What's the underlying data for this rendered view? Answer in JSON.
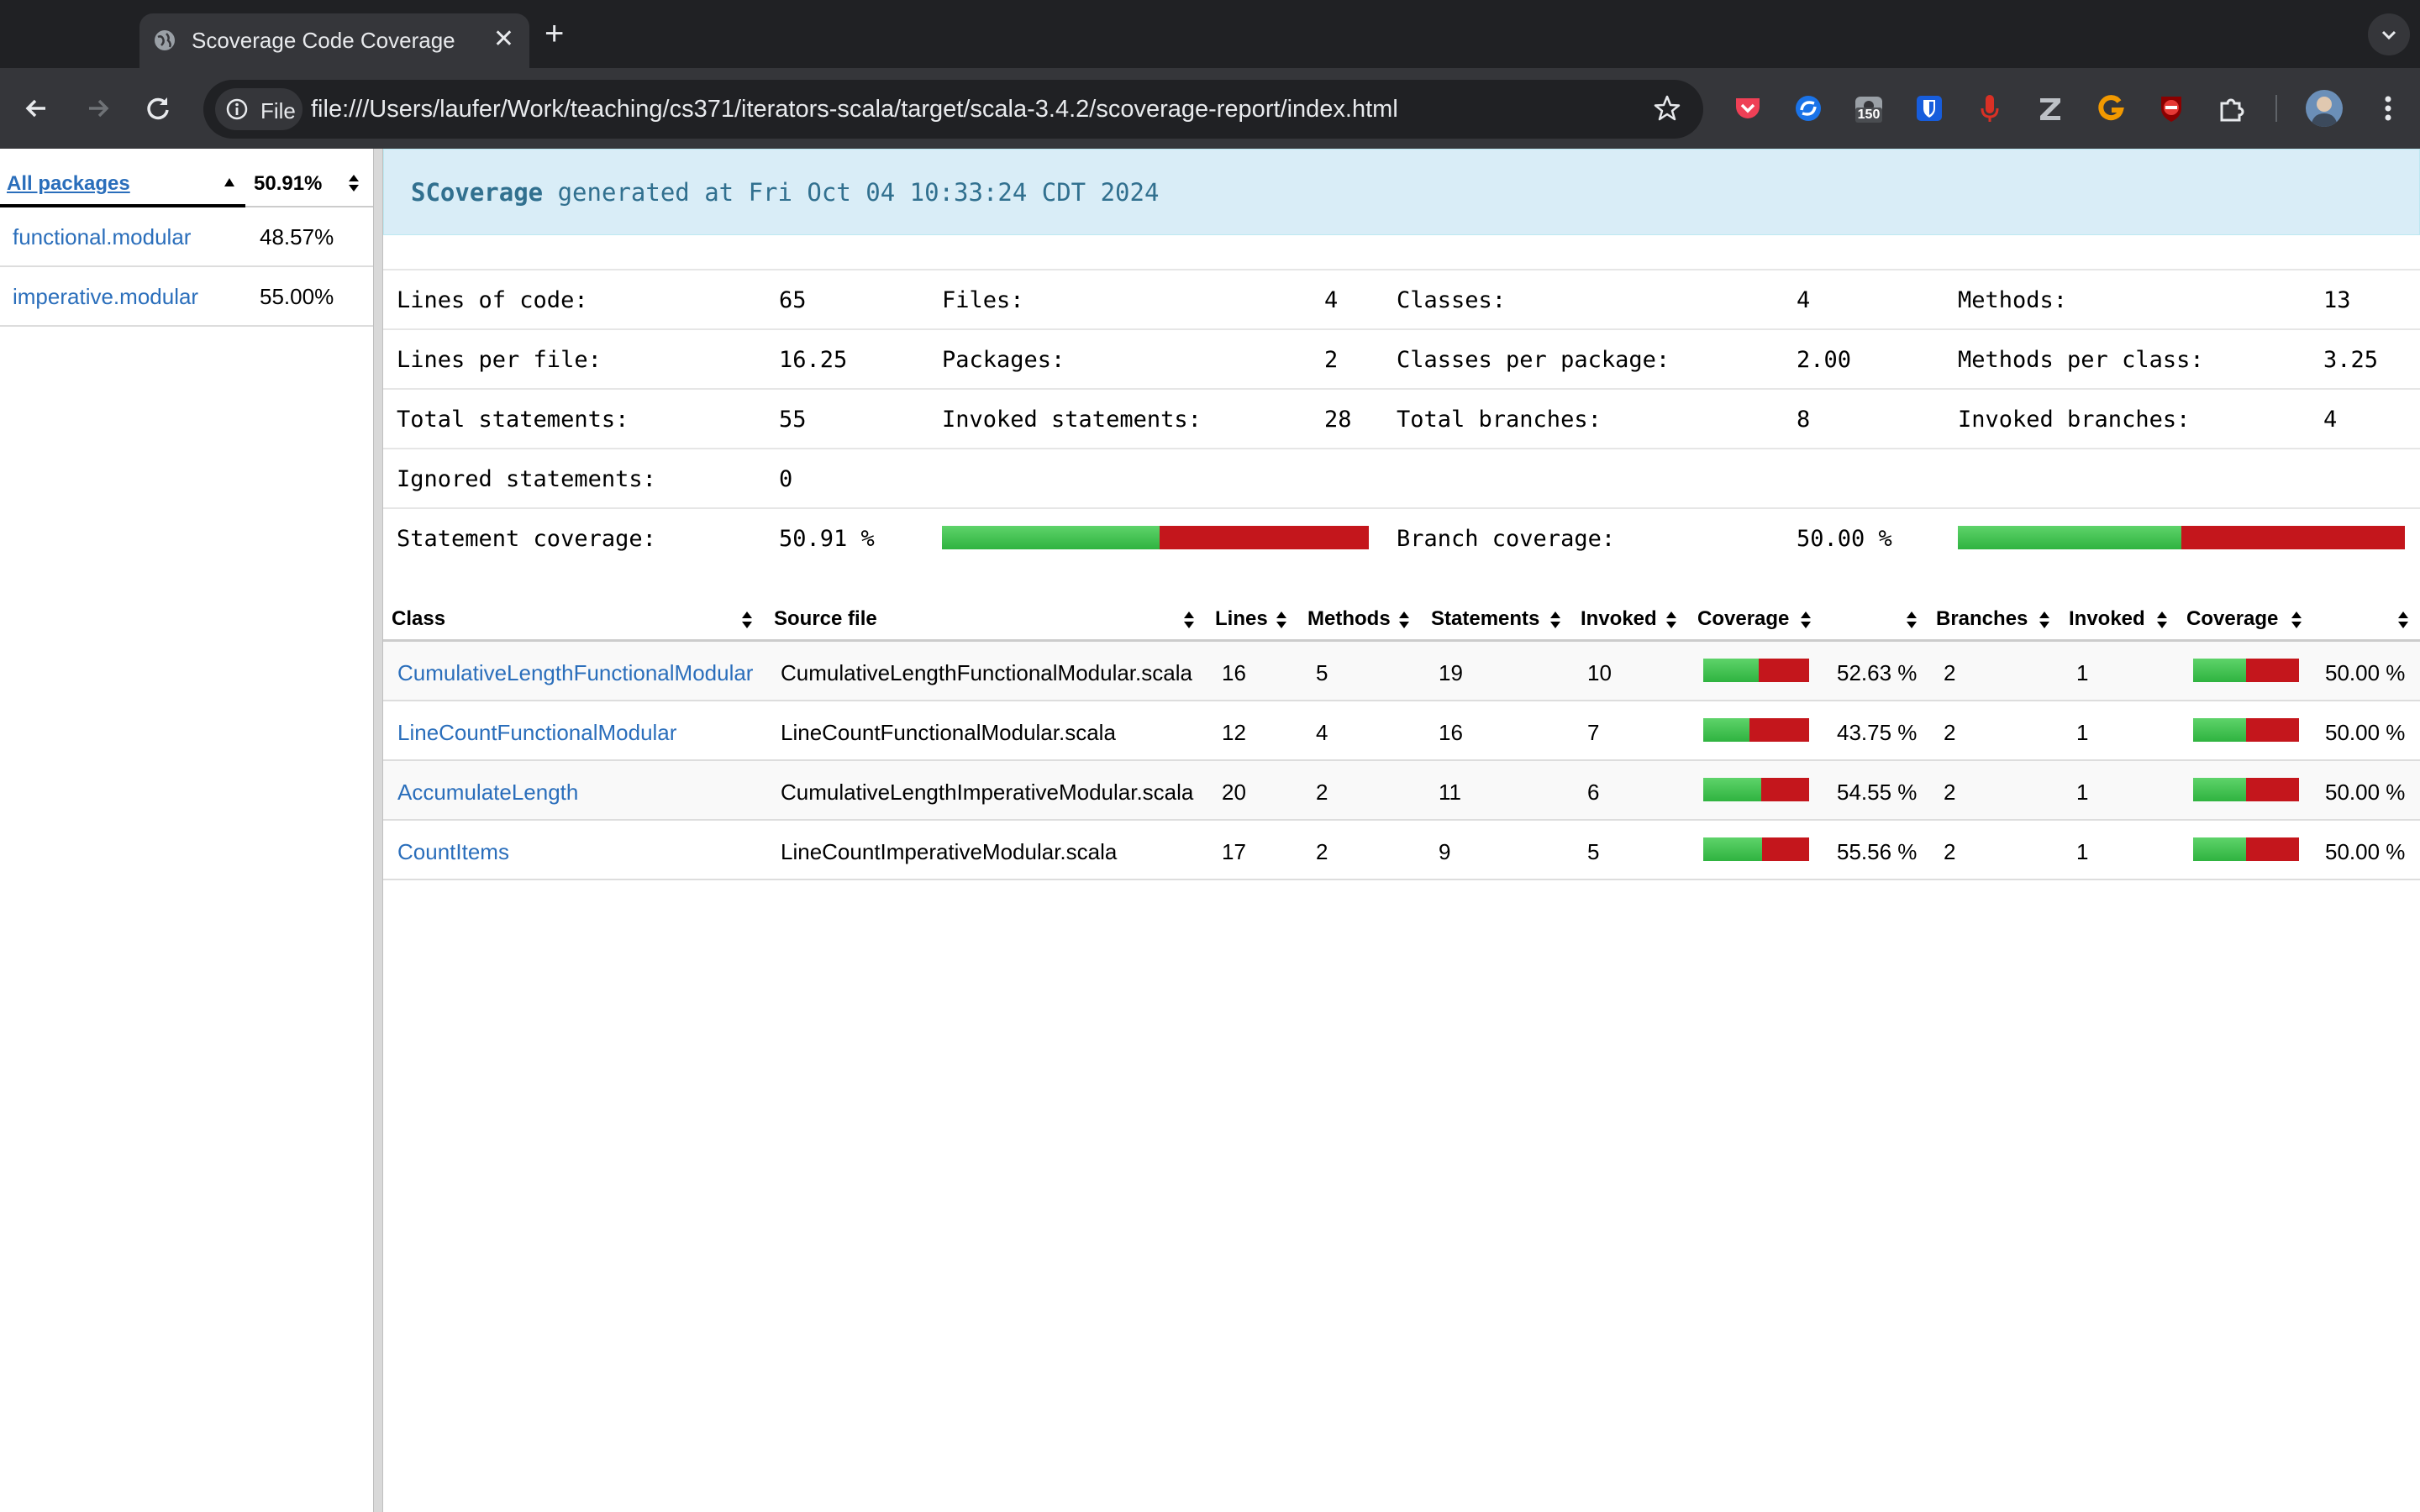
{
  "browser": {
    "tab_title": "Scoverage Code Coverage",
    "close_glyph": "✕",
    "new_tab_glyph": "+",
    "file_chip_label": "File",
    "url": "file:///Users/laufer/Work/teaching/cs371/iterators-scala/target/scala-3.4.2/scoverage-report/index.html",
    "ext_badge": "150"
  },
  "packages": {
    "header_name": "All packages",
    "header_pct": "50.91%",
    "items": [
      {
        "name": "functional.modular",
        "pct": "48.57%"
      },
      {
        "name": "imperative.modular",
        "pct": "55.00%"
      }
    ]
  },
  "banner": {
    "brand": "SCoverage",
    "text": " generated at Fri Oct 04 10:33:24 CDT 2024"
  },
  "stats": {
    "lines_of_code_label": "Lines of code:",
    "lines_of_code": "65",
    "files_label": "Files:",
    "files": "4",
    "classes_label": "Classes:",
    "classes": "4",
    "methods_label": "Methods:",
    "methods": "13",
    "lines_per_file_label": "Lines per file:",
    "lines_per_file": "16.25",
    "packages_label": "Packages:",
    "packages": "2",
    "classes_per_package_label": "Classes per package:",
    "classes_per_package": "2.00",
    "methods_per_class_label": "Methods per class:",
    "methods_per_class": "3.25",
    "total_statements_label": "Total statements:",
    "total_statements": "55",
    "invoked_statements_label": "Invoked statements:",
    "invoked_statements": "28",
    "total_branches_label": "Total branches:",
    "total_branches": "8",
    "invoked_branches_label": "Invoked branches:",
    "invoked_branches": "4",
    "ignored_statements_label": "Ignored statements:",
    "ignored_statements": "0",
    "statement_coverage_label": "Statement coverage:",
    "statement_coverage": "50.91 %",
    "statement_coverage_fraction": 0.5091,
    "branch_coverage_label": "Branch coverage:",
    "branch_coverage": "50.00 %",
    "branch_coverage_fraction": 0.5
  },
  "class_table": {
    "headers": {
      "class": "Class",
      "source": "Source file",
      "lines": "Lines",
      "methods": "Methods",
      "statements": "Statements",
      "invoked": "Invoked",
      "coverage": "Coverage",
      "branches": "Branches",
      "binvoked": "Invoked",
      "bcoverage": "Coverage"
    },
    "rows": [
      {
        "class": "CumulativeLengthFunctionalModular",
        "source": "CumulativeLengthFunctionalModular.scala",
        "lines": "16",
        "methods": "5",
        "statements": "19",
        "invoked": "10",
        "coverage": "52.63 %",
        "coverage_fraction": 0.5263,
        "branches": "2",
        "binvoked": "1",
        "bcoverage": "50.00 %",
        "bcoverage_fraction": 0.5
      },
      {
        "class": "LineCountFunctionalModular",
        "source": "LineCountFunctionalModular.scala",
        "lines": "12",
        "methods": "4",
        "statements": "16",
        "invoked": "7",
        "coverage": "43.75 %",
        "coverage_fraction": 0.4375,
        "branches": "2",
        "binvoked": "1",
        "bcoverage": "50.00 %",
        "bcoverage_fraction": 0.5
      },
      {
        "class": "AccumulateLength",
        "source": "CumulativeLengthImperativeModular.scala",
        "lines": "20",
        "methods": "2",
        "statements": "11",
        "invoked": "6",
        "coverage": "54.55 %",
        "coverage_fraction": 0.5455,
        "branches": "2",
        "binvoked": "1",
        "bcoverage": "50.00 %",
        "bcoverage_fraction": 0.5
      },
      {
        "class": "CountItems",
        "source": "LineCountImperativeModular.scala",
        "lines": "17",
        "methods": "2",
        "statements": "9",
        "invoked": "5",
        "coverage": "55.56 %",
        "coverage_fraction": 0.5556,
        "branches": "2",
        "binvoked": "1",
        "bcoverage": "50.00 %",
        "bcoverage_fraction": 0.5
      }
    ]
  },
  "colors": {
    "covered": "#2fb340",
    "uncovered": "#c4161c",
    "link": "#2a6ebb",
    "banner_bg": "#d9edf7"
  }
}
